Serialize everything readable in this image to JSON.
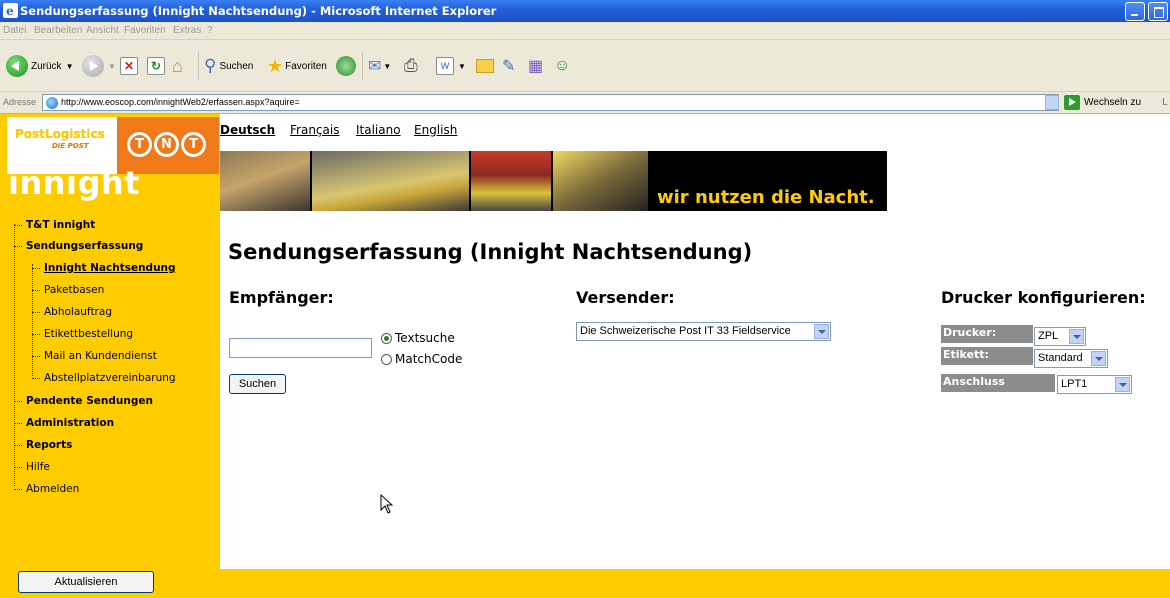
{
  "window": {
    "title": "Sendungserfassung (Innight Nachtsendung) - Microsoft Internet Explorer"
  },
  "menu": [
    "Datei",
    "Bearbeiten",
    "Ansicht",
    "Favoriten",
    "Extras",
    "?"
  ],
  "toolbar": {
    "back_label": "Zurück",
    "search_label": "Suchen",
    "favorites_label": "Favoriten"
  },
  "address": {
    "label": "Adresse",
    "url": "http://www.eoscop.com/innightWeb2/erfassen.aspx?aquire=",
    "go_label": "Wechseln zu",
    "links_label": "L"
  },
  "logo": {
    "postlogistics": "PostLogistics",
    "diepost": "DIE POST",
    "tnt": [
      "T",
      "N",
      "T"
    ],
    "innight": "innight"
  },
  "nav": {
    "items": [
      {
        "label": "T&T innight",
        "style": "bold"
      },
      {
        "label": "Sendungserfassung",
        "style": "bold"
      },
      {
        "label": "Innight Nachtsendung",
        "style": "selected"
      },
      {
        "label": "Paketbasen",
        "style": "normal"
      },
      {
        "label": "Abholauftrag",
        "style": "normal"
      },
      {
        "label": "Etikettbestellung",
        "style": "normal"
      },
      {
        "label": "Mail an Kundendienst",
        "style": "normal"
      },
      {
        "label": "Abstellplatzvereinbarung",
        "style": "normal"
      },
      {
        "label": "Pendente Sendungen",
        "style": "bold"
      },
      {
        "label": "Administration",
        "style": "bold"
      },
      {
        "label": "Reports",
        "style": "bold"
      },
      {
        "label": "Hilfe",
        "style": "normal"
      },
      {
        "label": "Abmelden",
        "style": "normal"
      }
    ],
    "refresh_button": "Aktualisieren"
  },
  "languages": [
    {
      "label": "Deutsch",
      "active": true
    },
    {
      "label": "Français",
      "active": false
    },
    {
      "label": "Italiano",
      "active": false
    },
    {
      "label": "English",
      "active": false
    }
  ],
  "banner": {
    "slogan": "wir nutzen die Nacht."
  },
  "main": {
    "title": "Sendungserfassung (Innight Nachtsendung)",
    "recipient": {
      "heading": "Empfänger:",
      "search_value": "",
      "options": [
        {
          "label": "Textsuche",
          "checked": true
        },
        {
          "label": "MatchCode",
          "checked": false
        }
      ],
      "search_button": "Suchen"
    },
    "sender": {
      "heading": "Versender:",
      "selected": "Die Schweizerische Post IT 33 Fieldservice"
    },
    "printer": {
      "heading": "Drucker konfigurieren:",
      "rows": [
        {
          "label": "Drucker:",
          "value": "ZPL"
        },
        {
          "label": "Etikett:",
          "value": "Standard"
        },
        {
          "label": "Anschluss",
          "value": "LPT1"
        }
      ]
    }
  },
  "colors": {
    "brand_yellow": "#ffcc00",
    "tnt_orange": "#f07a1a",
    "xp_blue": "#2360d8"
  }
}
